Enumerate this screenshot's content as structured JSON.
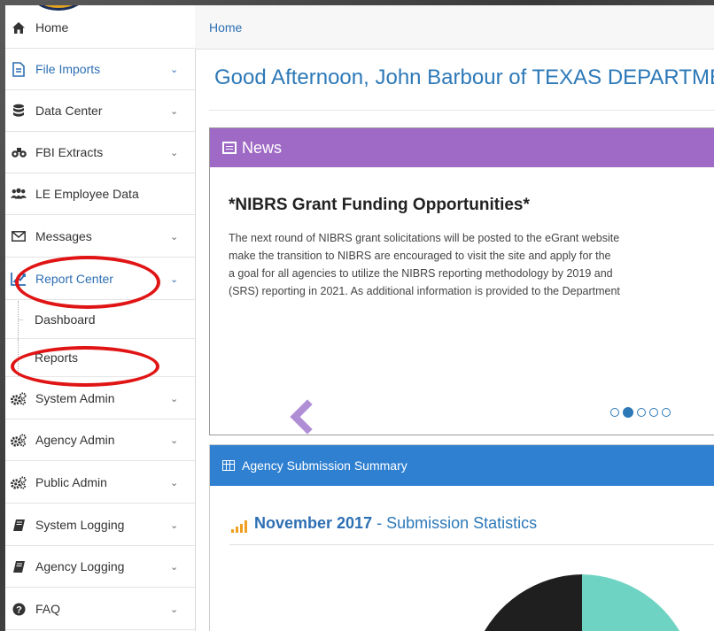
{
  "sidebar": {
    "items": [
      {
        "label": "Home",
        "icon": "home-icon",
        "has_chevron": false
      },
      {
        "label": "File Imports",
        "icon": "file-icon",
        "has_chevron": true
      },
      {
        "label": "Data Center",
        "icon": "database-icon",
        "has_chevron": true
      },
      {
        "label": "FBI Extracts",
        "icon": "binoculars-icon",
        "has_chevron": true
      },
      {
        "label": "LE Employee Data",
        "icon": "users-icon",
        "has_chevron": false
      },
      {
        "label": "Messages",
        "icon": "envelope-icon",
        "has_chevron": true
      },
      {
        "label": "Report Center",
        "icon": "chart-icon",
        "has_chevron": true,
        "expanded": true
      },
      {
        "label": "System Admin",
        "icon": "cogs-icon",
        "has_chevron": true
      },
      {
        "label": "Agency Admin",
        "icon": "cogs-icon",
        "has_chevron": true
      },
      {
        "label": "Public Admin",
        "icon": "cogs-icon",
        "has_chevron": true
      },
      {
        "label": "System Logging",
        "icon": "book-icon",
        "has_chevron": true
      },
      {
        "label": "Agency Logging",
        "icon": "book-icon",
        "has_chevron": true
      },
      {
        "label": "FAQ",
        "icon": "question-icon",
        "has_chevron": true
      }
    ],
    "report_center_sub": [
      {
        "label": "Dashboard"
      },
      {
        "label": "Reports"
      }
    ]
  },
  "breadcrumb": {
    "home": "Home"
  },
  "greeting": "Good Afternoon, John Barbour of TEXAS DEPARTMENT OF PUBLIC SAFETY",
  "news": {
    "header": "News",
    "title": "*NIBRS Grant Funding Opportunities*",
    "body_lines": [
      "The next round of NIBRS grant solicitations will be posted to the eGrant website",
      "make the transition to NIBRS are encouraged to visit the site and apply for the",
      "a goal for all agencies to utilize the NIBRS reporting methodology by 2019 and",
      "(SRS) reporting in 2021.  As additional information is provided to the Department"
    ],
    "carousel_active_index": 1,
    "carousel_count": 5
  },
  "summary": {
    "header": "Agency Submission Summary",
    "month": "November 2017",
    "separator": " - ",
    "subtitle": "Submission Statistics"
  },
  "colors": {
    "accent": "#2d79b8",
    "news_header": "#9f6ac5",
    "summary_header": "#2f80d1",
    "highlight": "#e01414",
    "pie_dark": "#1f1f1f",
    "pie_teal": "#6fd3c4"
  }
}
